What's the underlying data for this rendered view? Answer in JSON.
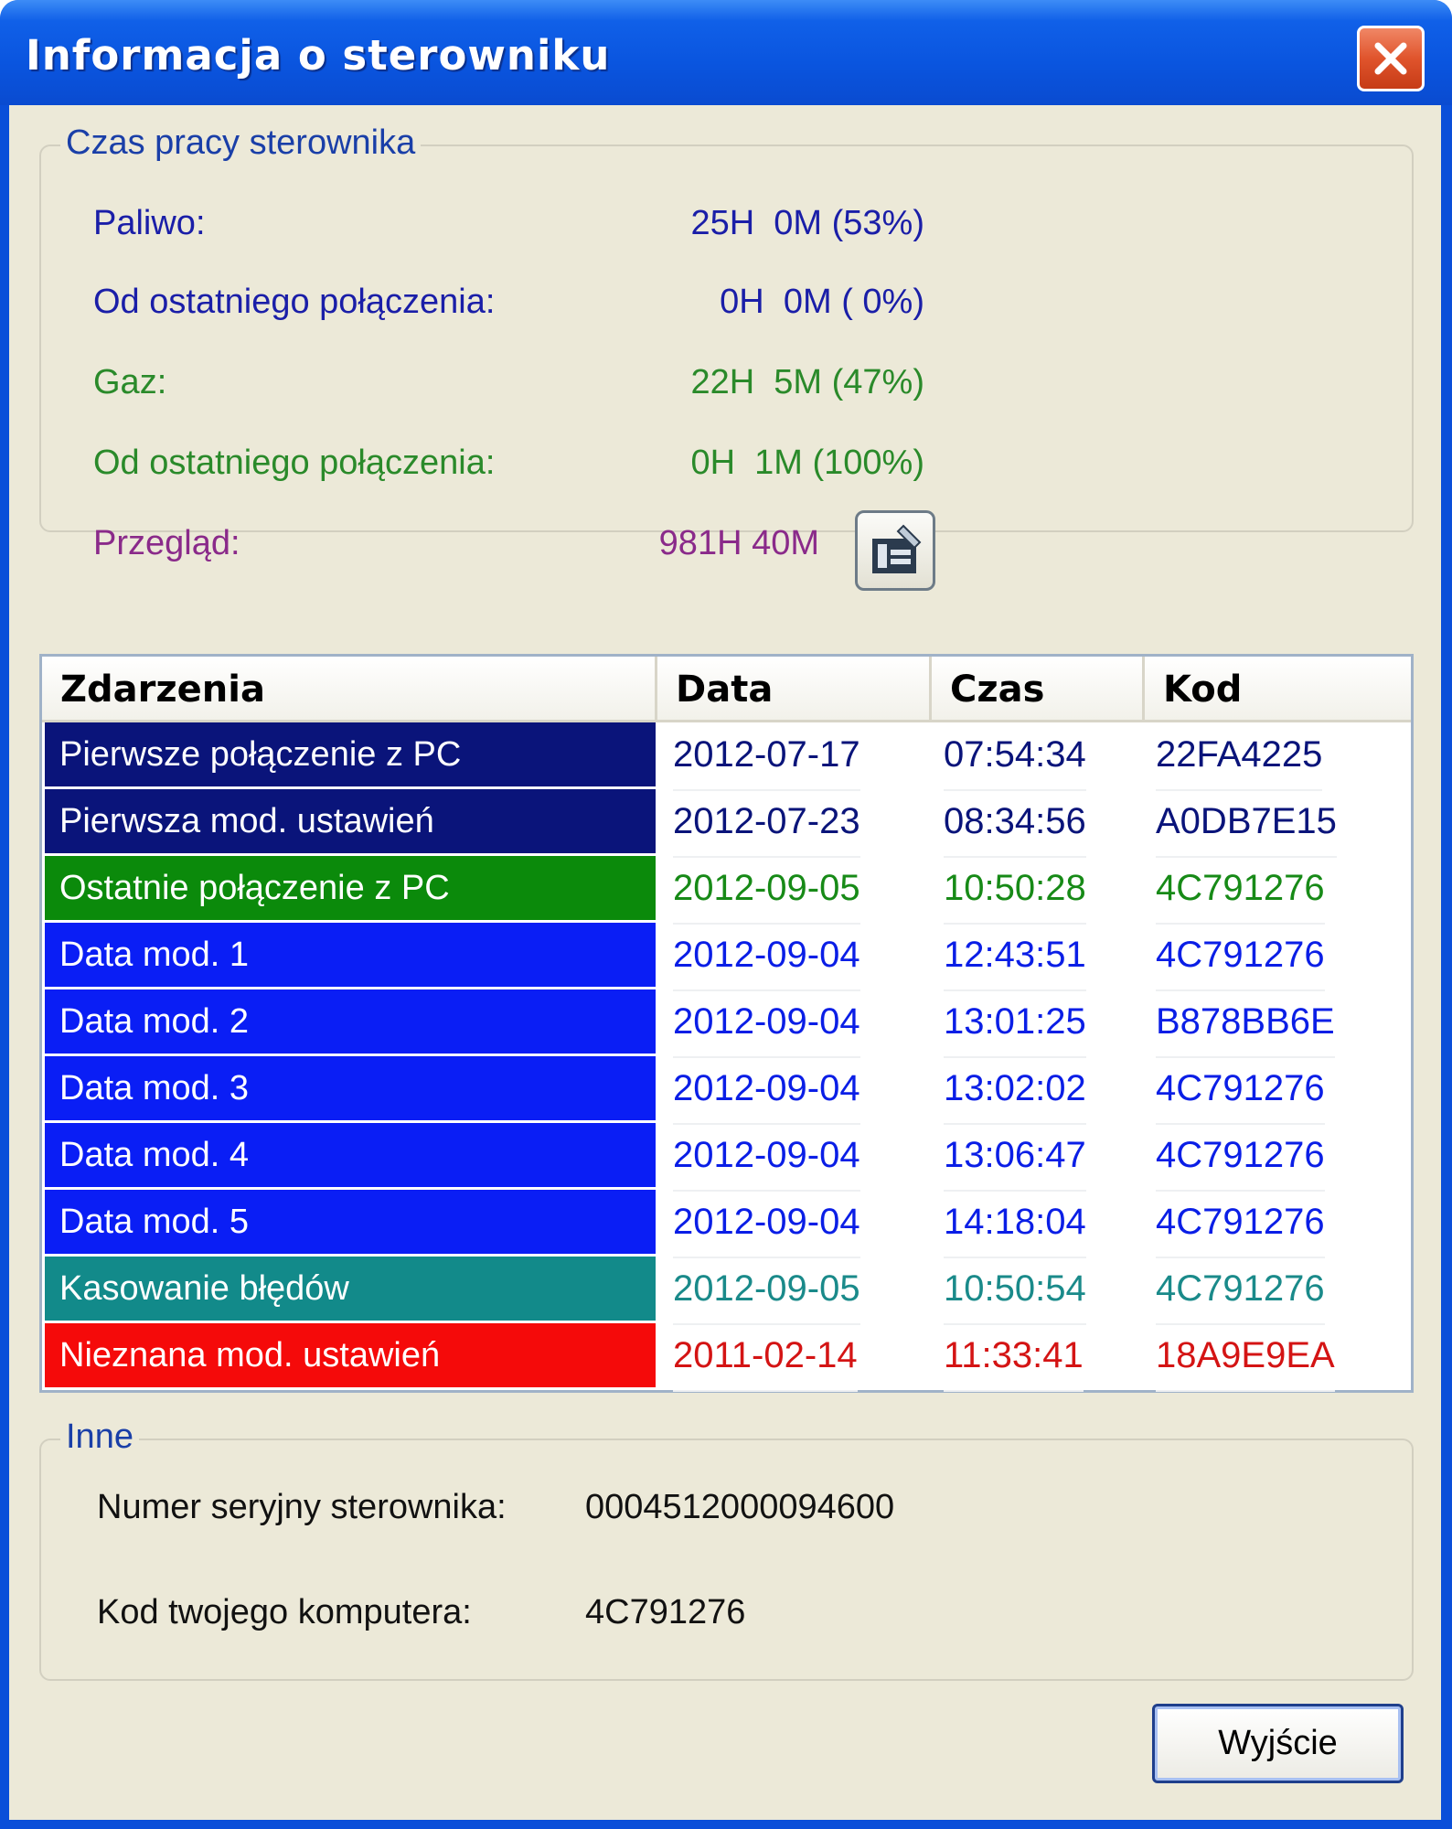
{
  "window": {
    "title": "Informacja o sterowniku"
  },
  "uptime": {
    "legend": "Czas pracy sterownika",
    "rows": [
      {
        "label": "Paliwo:",
        "value": "25H  0M (53%)",
        "color": "#1a1ea8"
      },
      {
        "label": "Od ostatniego połączenia:",
        "value": "0H  0M ( 0%)",
        "color": "#1a1ea8"
      },
      {
        "label": "Gaz:",
        "value": "22H  5M (47%)",
        "color": "#2a8a2a"
      },
      {
        "label": "Od ostatniego połączenia:",
        "value": "0H  1M (100%)",
        "color": "#2a8a2a"
      },
      {
        "label": "Przegląd:",
        "value": "981H 40M",
        "color": "#8a2a8a"
      }
    ],
    "overview_icon": "maintenance-icon"
  },
  "events": {
    "headers": [
      "Zdarzenia",
      "Data",
      "Czas",
      "Kod"
    ],
    "rows": [
      {
        "event": "Pierwsze połączenie z PC",
        "date": "2012-07-17",
        "time": "07:54:34",
        "code": "22FA4225",
        "bg": "#0a147a",
        "fg": "#0a147a"
      },
      {
        "event": "Pierwsza mod. ustawień",
        "date": "2012-07-23",
        "time": "08:34:56",
        "code": "A0DB7E15",
        "bg": "#0a147a",
        "fg": "#0a147a"
      },
      {
        "event": "Ostatnie połączenie z PC",
        "date": "2012-09-05",
        "time": "10:50:28",
        "code": "4C791276",
        "bg": "#0b8a0b",
        "fg": "#178a17"
      },
      {
        "event": "Data mod. 1",
        "date": "2012-09-04",
        "time": "12:43:51",
        "code": "4C791276",
        "bg": "#0a1ef5",
        "fg": "#0a1ee6"
      },
      {
        "event": "Data mod. 2",
        "date": "2012-09-04",
        "time": "13:01:25",
        "code": "B878BB6E",
        "bg": "#0a1ef5",
        "fg": "#0a1ee6"
      },
      {
        "event": "Data mod. 3",
        "date": "2012-09-04",
        "time": "13:02:02",
        "code": "4C791276",
        "bg": "#0a1ef5",
        "fg": "#0a1ee6"
      },
      {
        "event": "Data mod. 4",
        "date": "2012-09-04",
        "time": "13:06:47",
        "code": "4C791276",
        "bg": "#0a1ef5",
        "fg": "#0a1ee6"
      },
      {
        "event": "Data mod. 5",
        "date": "2012-09-04",
        "time": "14:18:04",
        "code": "4C791276",
        "bg": "#0a1ef5",
        "fg": "#0a1ee6"
      },
      {
        "event": "Kasowanie błędów",
        "date": "2012-09-05",
        "time": "10:50:54",
        "code": "4C791276",
        "bg": "#128a8a",
        "fg": "#1a8a8a"
      },
      {
        "event": "Nieznana mod. ustawień",
        "date": "2011-02-14",
        "time": "11:33:41",
        "code": "18A9E9EA",
        "bg": "#f50a0a",
        "fg": "#d41414"
      }
    ]
  },
  "other": {
    "legend": "Inne",
    "serial_label": "Numer seryjny sterownika:",
    "serial_value": "0004512000094600",
    "pc_code_label": "Kod twojego komputera:",
    "pc_code_value": "4C791276"
  },
  "buttons": {
    "exit_label": "Wyjście"
  },
  "colors": {
    "titlebar": "#0a55df",
    "client": "#ece9d8",
    "legend_text": "#1a3fa8"
  }
}
